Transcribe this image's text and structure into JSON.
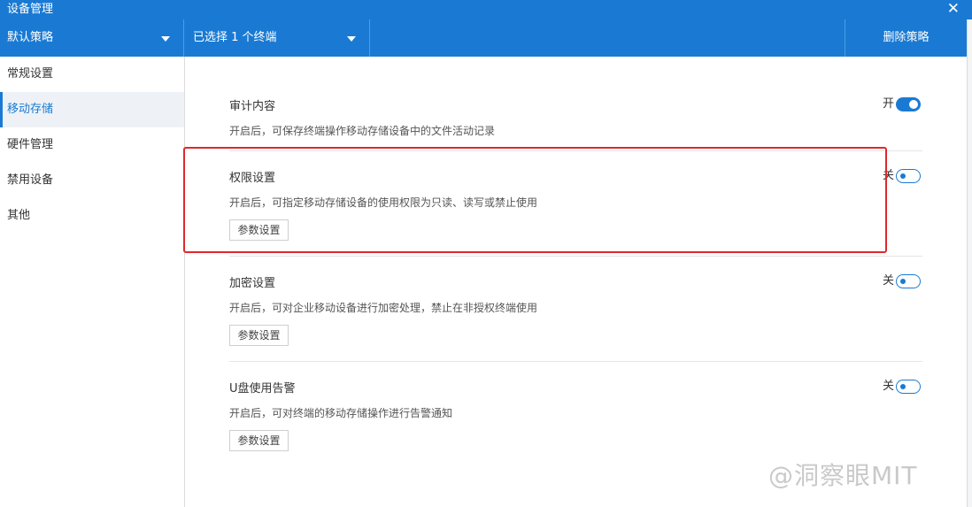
{
  "window": {
    "title": "设备管理",
    "close_glyph": "✕"
  },
  "toolbar": {
    "policy_select": "默认策略",
    "terminal_select": "已选择 1 个终端",
    "delete_label": "删除策略"
  },
  "sidebar": {
    "items": [
      {
        "label": "常规设置"
      },
      {
        "label": "移动存储",
        "active": true
      },
      {
        "label": "硬件管理"
      },
      {
        "label": "禁用设备"
      },
      {
        "label": "其他"
      }
    ]
  },
  "sections": [
    {
      "title": "审计内容",
      "description": "开启后，可保存终端操作移动存储设备中的文件活动记录",
      "toggle_label": "开",
      "enabled": true
    },
    {
      "title": "权限设置",
      "description": "开启后，可指定移动存储设备的使用权限为只读、读写或禁止使用",
      "toggle_label": "关",
      "enabled": false,
      "button_label": "参数设置"
    },
    {
      "title": "加密设置",
      "description": "开启后，可对企业移动设备进行加密处理，禁止在非授权终端使用",
      "toggle_label": "关",
      "enabled": false,
      "button_label": "参数设置"
    },
    {
      "title": "U盘使用告警",
      "description": "开启后，可对终端的移动存储操作进行告警通知",
      "toggle_label": "关",
      "enabled": false,
      "button_label": "参数设置"
    }
  ],
  "colors": {
    "accent": "#1a7ad3",
    "highlight_border": "#e0282c"
  },
  "watermark": "@洞察眼MIT"
}
